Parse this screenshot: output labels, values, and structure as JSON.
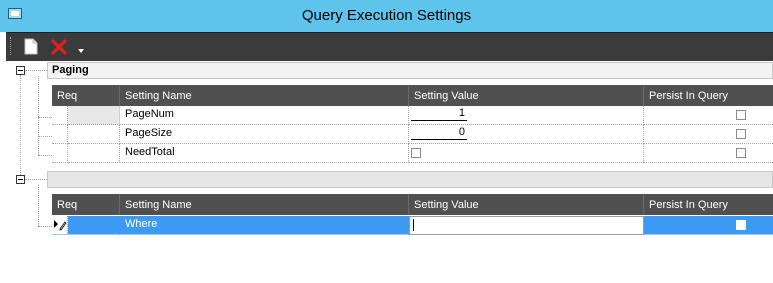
{
  "window": {
    "title": "Query Execution Settings"
  },
  "toolbar": {
    "new_icon": "new-document-icon",
    "delete_icon": "delete-x-icon",
    "dropdown_icon": "dropdown-arrow-icon"
  },
  "columns": [
    "Req",
    "Setting Name",
    "Setting Value",
    "Persist In Query"
  ],
  "groups": [
    {
      "name": "Paging",
      "rows": [
        {
          "setting_name": "PageNum",
          "setting_value": "1",
          "value_type": "number",
          "persist": false
        },
        {
          "setting_name": "PageSize",
          "setting_value": "0",
          "value_type": "number",
          "persist": false
        },
        {
          "setting_name": "NeedTotal",
          "setting_value": "",
          "value_type": "checkbox",
          "persist": false
        }
      ]
    },
    {
      "name": "",
      "rows": [
        {
          "setting_name": "Where",
          "setting_value": "",
          "value_type": "text",
          "persist": false,
          "active": true
        }
      ]
    }
  ],
  "colors": {
    "titlebar": "#5fc4ec",
    "toolbar": "#3b3b3b",
    "header": "#505050",
    "selection": "#3c9af2",
    "delete_icon": "#e02020"
  }
}
